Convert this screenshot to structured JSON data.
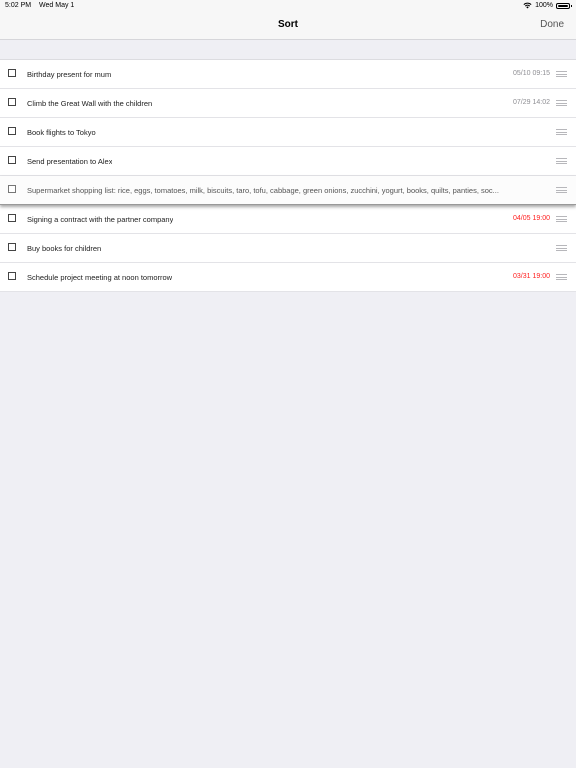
{
  "status_bar": {
    "time": "5:02 PM",
    "date": "Wed May 1",
    "battery": "100%"
  },
  "nav": {
    "title": "Sort",
    "done_label": "Done"
  },
  "tasks": [
    {
      "title": "Birthday present for mum",
      "date": "05/10 09:15",
      "overdue": false,
      "dragging": false
    },
    {
      "title": "Climb the Great Wall with the children",
      "date": "07/29 14:02",
      "overdue": false,
      "dragging": false
    },
    {
      "title": "Book flights to Tokyo",
      "date": "",
      "overdue": false,
      "dragging": false
    },
    {
      "title": "Send presentation to Alex",
      "date": "",
      "overdue": false,
      "dragging": false
    },
    {
      "title": "Supermarket shopping list: rice, eggs, tomatoes, milk, biscuits, taro, tofu, cabbage, green onions, zucchini, yogurt, books, quilts, panties, soc...",
      "date": "",
      "overdue": false,
      "dragging": true
    },
    {
      "title": "Signing a contract with the partner company",
      "date": "04/05 19:00",
      "overdue": true,
      "dragging": false
    },
    {
      "title": "Buy books for children",
      "date": "",
      "overdue": false,
      "dragging": false
    },
    {
      "title": "Schedule project meeting at noon tomorrow",
      "date": "03/31 19:00",
      "overdue": true,
      "dragging": false
    }
  ],
  "colors": {
    "overdue": "#ff1e1e",
    "background": "#efeff4"
  }
}
